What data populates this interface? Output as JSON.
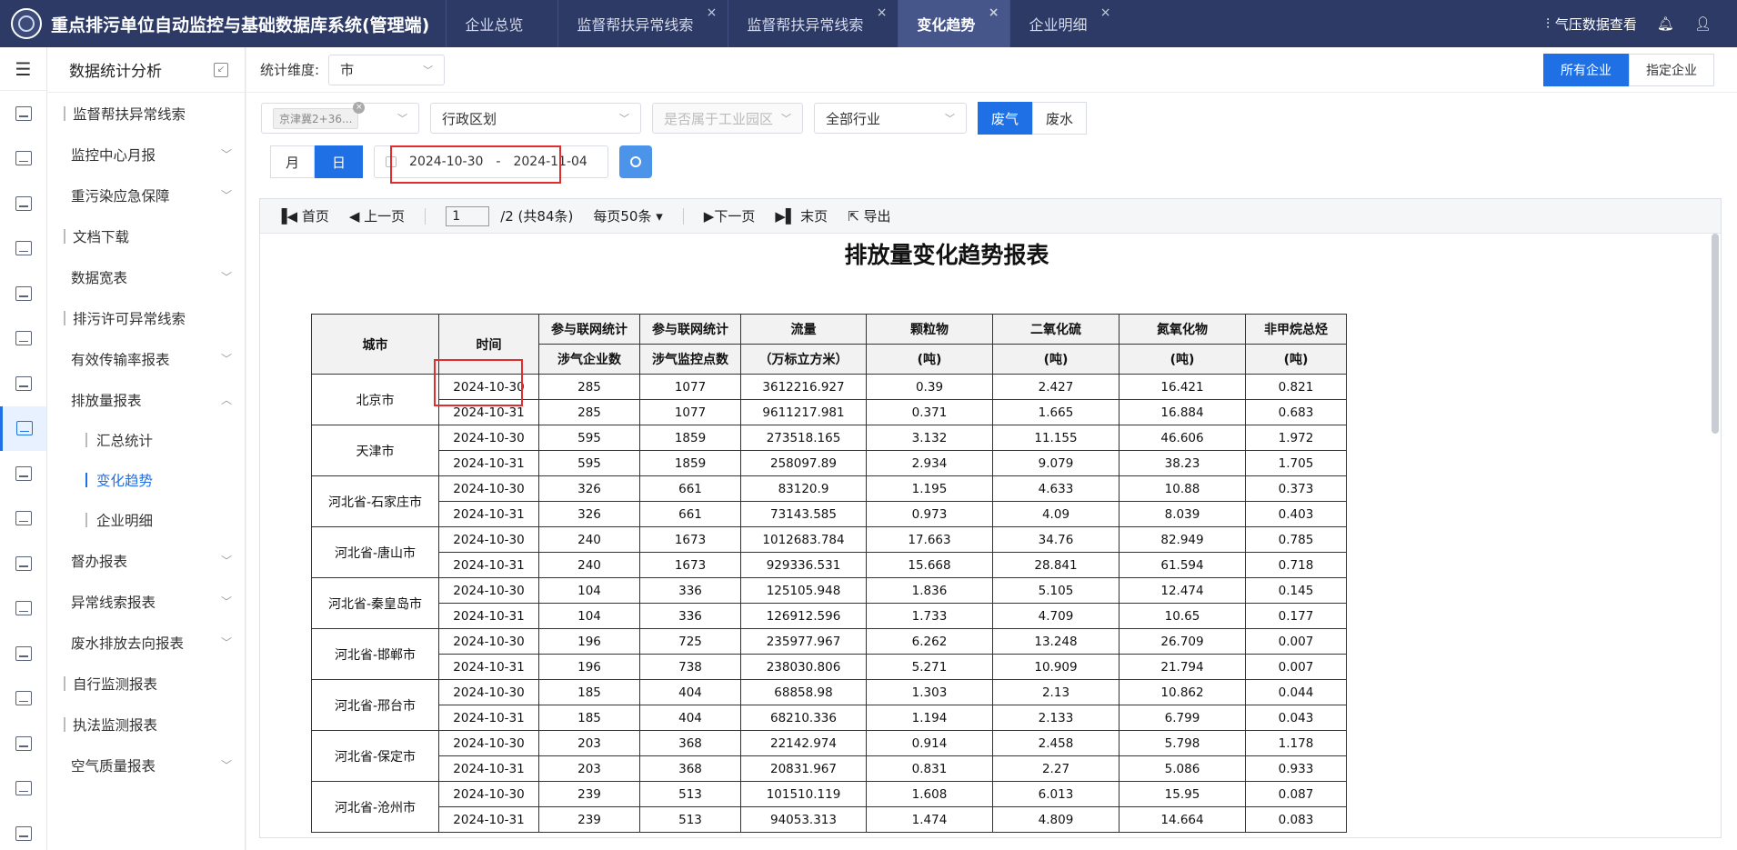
{
  "app": {
    "title": "重点排污单位自动监控与基础数据库系统(管理端)",
    "tabs": [
      {
        "label": "企业总览",
        "closable": false,
        "active": false
      },
      {
        "label": "监督帮扶异常线索",
        "closable": true,
        "active": false
      },
      {
        "label": "监督帮扶异常线索",
        "closable": true,
        "active": false
      },
      {
        "label": "变化趋势",
        "closable": true,
        "active": true
      },
      {
        "label": "企业明细",
        "closable": true,
        "active": false
      }
    ],
    "weather_link": "气压数据查看"
  },
  "nav": {
    "header": "数据统计分析",
    "items": [
      {
        "label": "监督帮扶异常线索",
        "type": "leaf"
      },
      {
        "label": "监控中心月报",
        "type": "group"
      },
      {
        "label": "重污染应急保障",
        "type": "group"
      },
      {
        "label": "文档下载",
        "type": "leaf"
      },
      {
        "label": "数据宽表",
        "type": "group"
      },
      {
        "label": "排污许可异常线索",
        "type": "leaf"
      },
      {
        "label": "有效传输率报表",
        "type": "group"
      },
      {
        "label": "排放量报表",
        "type": "open"
      },
      {
        "label": "汇总统计",
        "type": "sub"
      },
      {
        "label": "变化趋势",
        "type": "sub-active"
      },
      {
        "label": "企业明细",
        "type": "sub"
      },
      {
        "label": "督办报表",
        "type": "group"
      },
      {
        "label": "异常线索报表",
        "type": "group"
      },
      {
        "label": "废水排放去向报表",
        "type": "group"
      },
      {
        "label": "自行监测报表",
        "type": "leaf"
      },
      {
        "label": "执法监测报表",
        "type": "leaf"
      },
      {
        "label": "空气质量报表",
        "type": "group"
      }
    ]
  },
  "filters": {
    "dimension_label": "统计维度:",
    "dimension_value": "市",
    "scope_all": "所有企业",
    "scope_specified": "指定企业",
    "region_tag": "京津冀2+36...",
    "admin_region": "行政区划",
    "industrial_park": "是否属于工业园区",
    "industry": "全部行业",
    "type_gas": "废气",
    "type_water": "废水",
    "period_month": "月",
    "period_day": "日",
    "date_start": "2024-10-30",
    "date_sep": "-",
    "date_end": "2024-11-04"
  },
  "toolbar": {
    "first": "首页",
    "prev": "上一页",
    "page": "1",
    "page_info": "/2  (共84条)",
    "per_page": "每页50条",
    "next": "下一页",
    "last": "末页",
    "export": "导出"
  },
  "report": {
    "title": "排放量变化趋势报表",
    "headers": [
      [
        "城市"
      ],
      [
        "时间"
      ],
      [
        "参与联网统计",
        "涉气企业数"
      ],
      [
        "参与联网统计",
        "涉气监控点数"
      ],
      [
        "流量",
        "（万标立方米）"
      ],
      [
        "颗粒物",
        "(吨)"
      ],
      [
        "二氧化硫",
        "(吨)"
      ],
      [
        "氮氧化物",
        "(吨)"
      ],
      [
        "非甲烷总烃",
        "(吨)"
      ]
    ],
    "cities": [
      {
        "city": "北京市",
        "rows": [
          [
            "2024-10-30",
            "285",
            "1077",
            "3612216.927",
            "0.39",
            "2.427",
            "16.421",
            "0.821"
          ],
          [
            "2024-10-31",
            "285",
            "1077",
            "9611217.981",
            "0.371",
            "1.665",
            "16.884",
            "0.683"
          ]
        ]
      },
      {
        "city": "天津市",
        "rows": [
          [
            "2024-10-30",
            "595",
            "1859",
            "273518.165",
            "3.132",
            "11.155",
            "46.606",
            "1.972"
          ],
          [
            "2024-10-31",
            "595",
            "1859",
            "258097.89",
            "2.934",
            "9.079",
            "38.23",
            "1.705"
          ]
        ]
      },
      {
        "city": "河北省-石家庄市",
        "rows": [
          [
            "2024-10-30",
            "326",
            "661",
            "83120.9",
            "1.195",
            "4.633",
            "10.88",
            "0.373"
          ],
          [
            "2024-10-31",
            "326",
            "661",
            "73143.585",
            "0.973",
            "4.09",
            "8.039",
            "0.403"
          ]
        ]
      },
      {
        "city": "河北省-唐山市",
        "rows": [
          [
            "2024-10-30",
            "240",
            "1673",
            "1012683.784",
            "17.663",
            "34.76",
            "82.949",
            "0.785"
          ],
          [
            "2024-10-31",
            "240",
            "1673",
            "929336.531",
            "15.668",
            "28.841",
            "61.594",
            "0.718"
          ]
        ]
      },
      {
        "city": "河北省-秦皇岛市",
        "rows": [
          [
            "2024-10-30",
            "104",
            "336",
            "125105.948",
            "1.836",
            "5.105",
            "12.474",
            "0.145"
          ],
          [
            "2024-10-31",
            "104",
            "336",
            "126912.596",
            "1.733",
            "4.709",
            "10.65",
            "0.177"
          ]
        ]
      },
      {
        "city": "河北省-邯郸市",
        "rows": [
          [
            "2024-10-30",
            "196",
            "725",
            "235977.967",
            "6.262",
            "13.248",
            "26.709",
            "0.007"
          ],
          [
            "2024-10-31",
            "196",
            "738",
            "238030.806",
            "5.271",
            "10.909",
            "21.794",
            "0.007"
          ]
        ]
      },
      {
        "city": "河北省-邢台市",
        "rows": [
          [
            "2024-10-30",
            "185",
            "404",
            "68858.98",
            "1.303",
            "2.13",
            "10.862",
            "0.044"
          ],
          [
            "2024-10-31",
            "185",
            "404",
            "68210.336",
            "1.194",
            "2.133",
            "6.799",
            "0.043"
          ]
        ]
      },
      {
        "city": "河北省-保定市",
        "rows": [
          [
            "2024-10-30",
            "203",
            "368",
            "22142.974",
            "0.914",
            "2.458",
            "5.798",
            "1.178"
          ],
          [
            "2024-10-31",
            "203",
            "368",
            "20831.967",
            "0.831",
            "2.27",
            "5.086",
            "0.933"
          ]
        ]
      },
      {
        "city": "河北省-沧州市",
        "rows": [
          [
            "2024-10-30",
            "239",
            "513",
            "101510.119",
            "1.608",
            "6.013",
            "15.95",
            "0.087"
          ],
          [
            "2024-10-31",
            "239",
            "513",
            "94053.313",
            "1.474",
            "4.809",
            "14.664",
            "0.083"
          ]
        ]
      }
    ]
  },
  "colors": {
    "topbar": "#2d3a66",
    "accent": "#1f6fe5",
    "highlight": "#e12d2d"
  }
}
